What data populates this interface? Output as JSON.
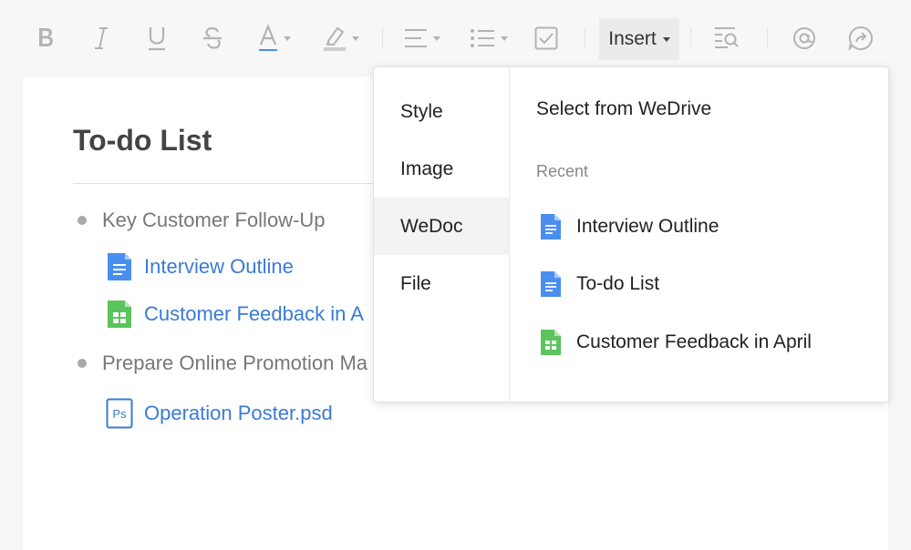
{
  "toolbar": {
    "bold_icon": "bold-icon",
    "italic_icon": "italic-icon",
    "underline_icon": "underline-icon",
    "strikethrough_icon": "strikethrough-icon",
    "font_color_icon": "font-color-icon",
    "highlight_icon": "highlight-icon",
    "align_icon": "align-icon",
    "list_icon": "bulleted-list-icon",
    "checkbox_icon": "checkbox-icon",
    "insert_label": "Insert",
    "find_icon": "find-replace-icon",
    "mention_icon": "mention-icon",
    "share_icon": "share-icon",
    "font_color_underline": "#4a90e2"
  },
  "document": {
    "title": "To-do List",
    "bullets": [
      {
        "text": "Key Customer Follow-Up",
        "files": [
          {
            "name": "Interview Outline",
            "type": "doc"
          },
          {
            "name": "Customer Feedback in A",
            "type": "sheet"
          }
        ]
      },
      {
        "text": "Prepare Online Promotion Ma",
        "files": [
          {
            "name": "Operation Poster.psd",
            "type": "psd"
          }
        ]
      }
    ]
  },
  "insert_menu": {
    "categories": [
      "Style",
      "Image",
      "WeDoc",
      "File"
    ],
    "active_category": "WeDoc",
    "header": "Select from WeDrive",
    "recent_label": "Recent",
    "recent_items": [
      {
        "name": "Interview Outline",
        "type": "doc"
      },
      {
        "name": "To-do List",
        "type": "doc"
      },
      {
        "name": "Customer Feedback in April",
        "type": "sheet"
      }
    ]
  },
  "colors": {
    "doc_icon": "#4a8ff0",
    "sheet_icon": "#5cc45c",
    "psd_icon": "#3a7bd5",
    "link": "#3a7bd5",
    "toolbar_icon": "#b3b3b3"
  }
}
